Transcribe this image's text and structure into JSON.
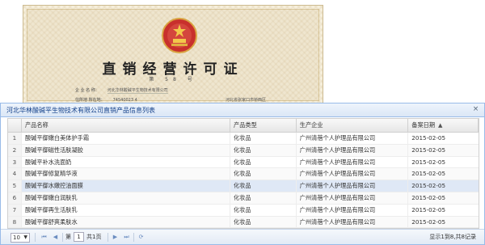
{
  "certificate": {
    "title": "直销经营许可证",
    "number_label": "第 58 号",
    "field_1_label": "企 业 名 称：",
    "field_1_value": "河北华林酸碱平生物技术有限公司",
    "field_2_label": "住所地 所在地：",
    "field_2_value": "74540023 4",
    "aside_text": "河北省张家口市桥西区"
  },
  "dialog": {
    "title": "河北华林酸碱平生物技术有限公司直销产品信息列表",
    "close_glyph": "×"
  },
  "table": {
    "columns": [
      "产品名称",
      "产品类型",
      "生产企业",
      "备案日期"
    ],
    "sort_indicator": "▲",
    "rows": [
      {
        "num": "1",
        "name": "酸碱平御嫩白美体护手霜",
        "type": "化妆品",
        "company": "广州清蓓个人护理品有限公司",
        "date": "2015-02-05"
      },
      {
        "num": "2",
        "name": "酸碱平御磁性活肤凝胶",
        "type": "化妆品",
        "company": "广州清蓓个人护理品有限公司",
        "date": "2015-02-05"
      },
      {
        "num": "3",
        "name": "酸碱平补水洗面奶",
        "type": "化妆品",
        "company": "广州清蓓个人护理品有限公司",
        "date": "2015-02-05"
      },
      {
        "num": "4",
        "name": "酸碱平御修复精华液",
        "type": "化妆品",
        "company": "广州清蓓个人护理品有限公司",
        "date": "2015-02-05"
      },
      {
        "num": "5",
        "name": "酸碱平御水嫩控油面膜",
        "type": "化妆品",
        "company": "广州清蓓个人护理品有限公司",
        "date": "2015-02-05"
      },
      {
        "num": "6",
        "name": "酸碱平御嫩白润肤乳",
        "type": "化妆品",
        "company": "广州清蓓个人护理品有限公司",
        "date": "2015-02-05"
      },
      {
        "num": "7",
        "name": "酸碱平御再生活肤乳",
        "type": "化妆品",
        "company": "广州清蓓个人护理品有限公司",
        "date": "2015-02-05"
      },
      {
        "num": "8",
        "name": "酸碱平御舒爽柔肤水",
        "type": "化妆品",
        "company": "广州清蓓个人护理品有限公司",
        "date": "2015-02-05"
      }
    ],
    "selected_row": "5"
  },
  "pager": {
    "page_size": "10",
    "page_label_prefix": "第",
    "current_page": "1",
    "page_label_suffix": "共1页",
    "info": "显示1到8,共8记录"
  },
  "colors": {
    "header_accent": "#15428b",
    "selected_row": "#dfe8f6",
    "border": "#99bbe8"
  },
  "icons": [
    "emblem-icon",
    "close-icon",
    "first-page-icon",
    "prev-page-icon",
    "next-page-icon",
    "last-page-icon",
    "refresh-icon",
    "dropdown-caret-icon"
  ]
}
